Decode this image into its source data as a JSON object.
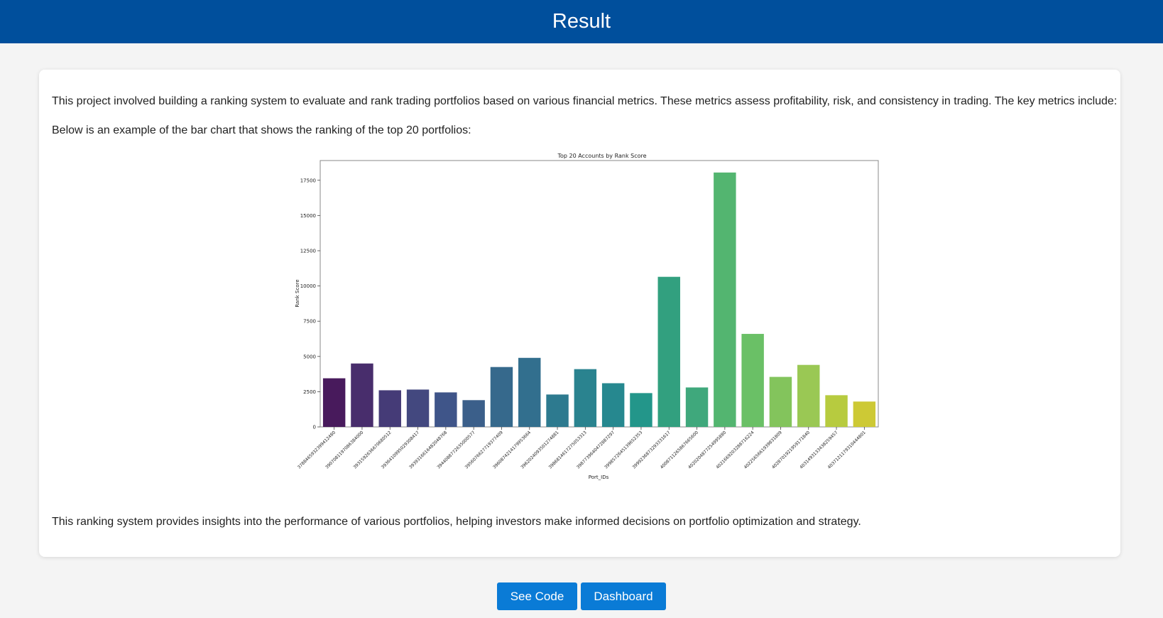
{
  "header": {
    "title": "Result"
  },
  "content": {
    "intro": "This project involved building a ranking system to evaluate and rank trading portfolios based on various financial metrics. These metrics assess profitability, risk, and consistency in trading. The key metrics include:",
    "chart_intro": "Below is an example of the bar chart that shows the ranking of the top 20 portfolios:",
    "conclusion": "This ranking system provides insights into the performance of various portfolios, helping investors make informed decisions on portfolio optimization and strategy."
  },
  "buttons": {
    "see_code": "See Code",
    "dashboard": "Dashboard"
  },
  "chart_data": {
    "type": "bar",
    "title": "Top 20 Accounts by Rank Score",
    "xlabel": "Port_IDs",
    "ylabel": "Rank Score",
    "ylim": [
      0,
      18900
    ],
    "yticks": [
      0,
      2500,
      5000,
      7500,
      10000,
      12500,
      15000,
      17500
    ],
    "grid": false,
    "categories": [
      "3788465932399412480",
      "3907081197086384000",
      "3931592636670680512",
      "3936410995029308417",
      "3939316616482048768",
      "3944088772635000577",
      "3956076627719377409",
      "3960874214179953664",
      "3962024093501274881",
      "3986814617275053313",
      "3987739640472887297",
      "3998572645139652353",
      "3999236873293331617",
      "4008711265867665600",
      "4020204877254995880",
      "4021669203288716224",
      "4022565661939831809",
      "4028701921959171840",
      "4031493133438259457",
      "4037121179310444801"
    ],
    "values": [
      3450,
      4500,
      2600,
      2650,
      2450,
      1900,
      4250,
      4900,
      2300,
      4100,
      3100,
      2400,
      10650,
      2800,
      18050,
      6600,
      3550,
      4400,
      2250,
      1800
    ],
    "colors": [
      "#481a5c",
      "#482d6c",
      "#453b77",
      "#43487f",
      "#3f5589",
      "#3b5f8a",
      "#36698c",
      "#326f8e",
      "#2d7a8f",
      "#2a838f",
      "#26888f",
      "#23968a",
      "#32a07f",
      "#3fa87c",
      "#53b570",
      "#6ac066",
      "#83c45c",
      "#9ac854",
      "#b7cb3f",
      "#cdc935"
    ]
  }
}
